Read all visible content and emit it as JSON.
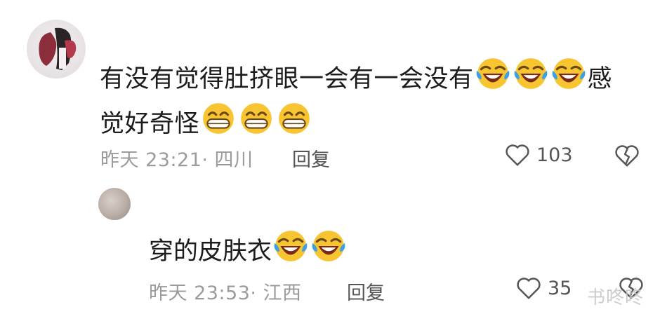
{
  "comment": {
    "text_line1": "有没有觉得肚挤眼一会有一会没有",
    "text_line1_tail": "感",
    "text_line2": "觉好奇怪",
    "meta": "昨天 23:21· 四川",
    "reply_label": "回复",
    "likes": "103"
  },
  "reply": {
    "text": "穿的皮肤衣",
    "meta": "昨天 23:53· 江西",
    "reply_label": "回复",
    "likes": "35"
  },
  "watermark": "书咚咚",
  "icons": {
    "laugh_cry": "laugh-cry-emoji-icon",
    "grin": "grin-emoji-icon",
    "heart": "heart-icon",
    "broken_heart": "broken-heart-icon"
  },
  "colors": {
    "emoji_yellow": "#f7c531",
    "meta_gray": "#9b9b9b",
    "action_gray": "#555555"
  }
}
